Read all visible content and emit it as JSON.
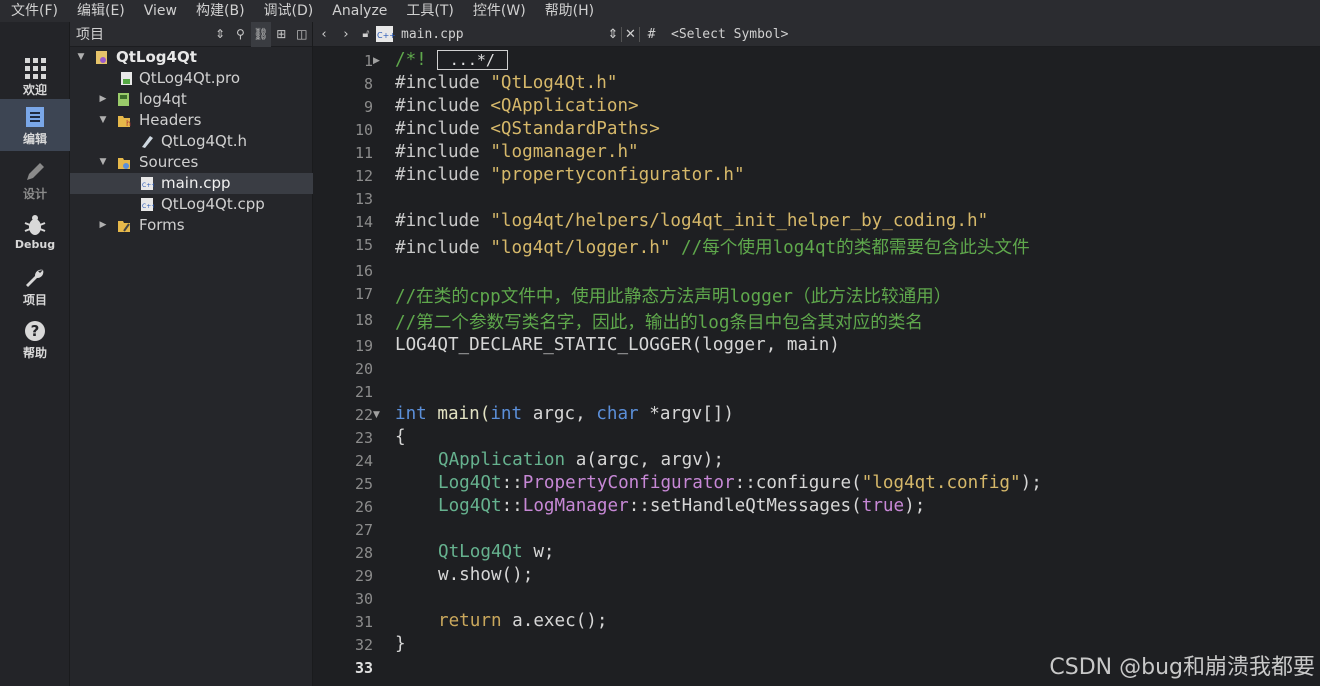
{
  "menu": [
    "文件(F)",
    "编辑(E)",
    "View",
    "构建(B)",
    "调试(D)",
    "Analyze",
    "工具(T)",
    "控件(W)",
    "帮助(H)"
  ],
  "modes": {
    "welcome": "欢迎",
    "edit": "编辑",
    "design": "设计",
    "debug": "Debug",
    "project": "项目",
    "help": "帮助"
  },
  "project_pane": {
    "title": "项目",
    "tree": {
      "root": "QtLog4Qt",
      "pro": "QtLog4Qt.pro",
      "lib": "log4qt",
      "headers": "Headers",
      "header1": "QtLog4Qt.h",
      "sources": "Sources",
      "src1": "main.cpp",
      "src2": "QtLog4Qt.cpp",
      "forms": "Forms"
    }
  },
  "editor_bar": {
    "file": "main.cpp",
    "hash": "#",
    "symbol": "<Select Symbol>"
  },
  "fold_placeholder": "...*/",
  "line_numbers": [
    "1",
    "8",
    "9",
    "10",
    "11",
    "12",
    "13",
    "14",
    "15",
    "16",
    "17",
    "18",
    "19",
    "20",
    "21",
    "22",
    "23",
    "24",
    "25",
    "26",
    "27",
    "28",
    "29",
    "30",
    "31",
    "32",
    "33"
  ],
  "code": {
    "l1": "/*!",
    "l8a": "#include ",
    "l8b": "\"QtLog4Qt.h\"",
    "l9a": "#include ",
    "l9b": "<QApplication>",
    "l10a": "#include ",
    "l10b": "<QStandardPaths>",
    "l11a": "#include ",
    "l11b": "\"logmanager.h\"",
    "l12a": "#include ",
    "l12b": "\"propertyconfigurator.h\"",
    "l14a": "#include ",
    "l14b": "\"log4qt/helpers/log4qt_init_helper_by_coding.h\"",
    "l15a": "#include ",
    "l15b": "\"log4qt/logger.h\"",
    "l15c": " //每个使用log4qt的类都需要包含此头文件",
    "l17": "//在类的cpp文件中，使用此静态方法声明logger（此方法比较通用）",
    "l18": "//第二个参数写类名字，因此，输出的log条目中包含其对应的类名",
    "l19": "LOG4QT_DECLARE_STATIC_LOGGER(logger, main)",
    "l22a": "int",
    "l22b": " main(",
    "l22c": "int",
    "l22d": " argc, ",
    "l22e": "char",
    "l22f": " *argv[])",
    "l23": "{",
    "l24a": "QApplication",
    "l24b": " a(argc, argv);",
    "l25a": "Log4Qt",
    "l25b": "::",
    "l25c": "PropertyConfigurator",
    "l25d": "::configure(",
    "l25e": "\"log4qt.config\"",
    "l25f": ");",
    "l26a": "Log4Qt",
    "l26b": "::",
    "l26c": "LogManager",
    "l26d": "::setHandleQtMessages(",
    "l26e": "true",
    "l26f": ");",
    "l28a": "QtLog4Qt",
    "l28b": " w;",
    "l29": "w.show();",
    "l31a": "return",
    "l31b": " a.exec();",
    "l32": "}"
  },
  "watermark": "CSDN @bug和崩溃我都要"
}
